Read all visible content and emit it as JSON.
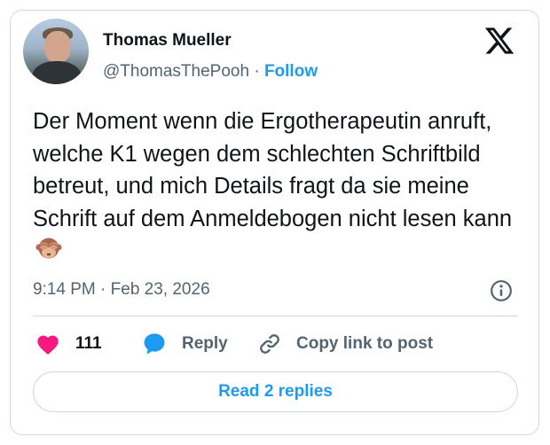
{
  "author": {
    "name": "Thomas Mueller",
    "handle": "@ThomasThePooh",
    "separator": "·",
    "follow_label": "Follow"
  },
  "tweet": {
    "text": "Der Moment wenn die Ergotherapeutin anruft, welche K1 wegen dem schlechten Schriftbild betreut, und mich Details fragt da sie meine Schrift auf dem Anmeldebogen nicht lesen kann",
    "emoji_icon": "see-no-evil-monkey-icon"
  },
  "meta": {
    "time": "9:14 PM",
    "separator": "·",
    "date": "Feb 23, 2026"
  },
  "actions": {
    "like_count": "111",
    "reply_label": "Reply",
    "copy_label": "Copy link to post"
  },
  "read_replies_label": "Read 2 replies",
  "colors": {
    "accent": "#1d9bf0",
    "like": "#f91880",
    "secondary_text": "#536471",
    "border": "#cfd9de"
  }
}
